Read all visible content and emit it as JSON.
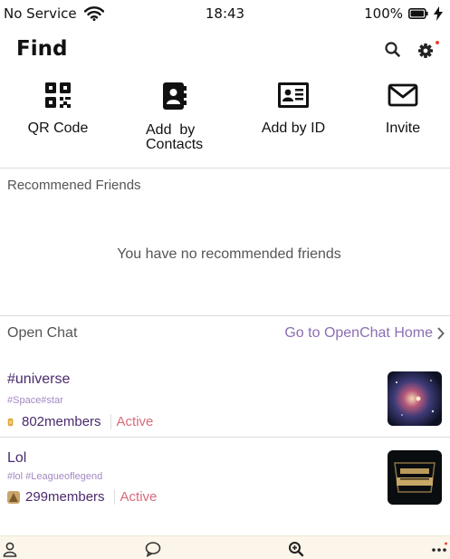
{
  "status_bar": {
    "carrier": "No Service",
    "time": "18:43",
    "battery": "100%"
  },
  "header": {
    "title": "Find",
    "search_icon": "search-icon",
    "settings_icon": "gear-icon"
  },
  "actions": [
    {
      "label": "QR Code",
      "icon": "qr-code-icon"
    },
    {
      "label": "Add  by\nContacts",
      "icon": "contacts-book-icon"
    },
    {
      "label": "Add by ID",
      "icon": "id-card-icon"
    },
    {
      "label": "Invite",
      "icon": "envelope-icon"
    }
  ],
  "recommended": {
    "title": "Recommened Friends",
    "empty_message": "You have no recommended friends"
  },
  "open_chat": {
    "title": "Open Chat",
    "home_link": "Go to OpenChat Home",
    "items": [
      {
        "name": "#universe",
        "tags": "#Space#star",
        "members": "802members",
        "status": "Active",
        "thumb": "galaxy-image"
      },
      {
        "name": "Lol",
        "tags": "#lol #Leagueoflegend",
        "members": "299members",
        "status": "Active",
        "thumb": "league-of-legends-logo"
      }
    ]
  },
  "bottom_nav": [
    "person-icon",
    "chat-bubble-icon",
    "find-icon",
    "more-icon"
  ],
  "colors": {
    "accent_purple": "#8c6db4",
    "chat_name": "#4a2a6c",
    "tag": "#a488c4",
    "active": "#d86b7b",
    "nav_bg": "#fcf6ea",
    "notification_dot": "#e8472f"
  }
}
